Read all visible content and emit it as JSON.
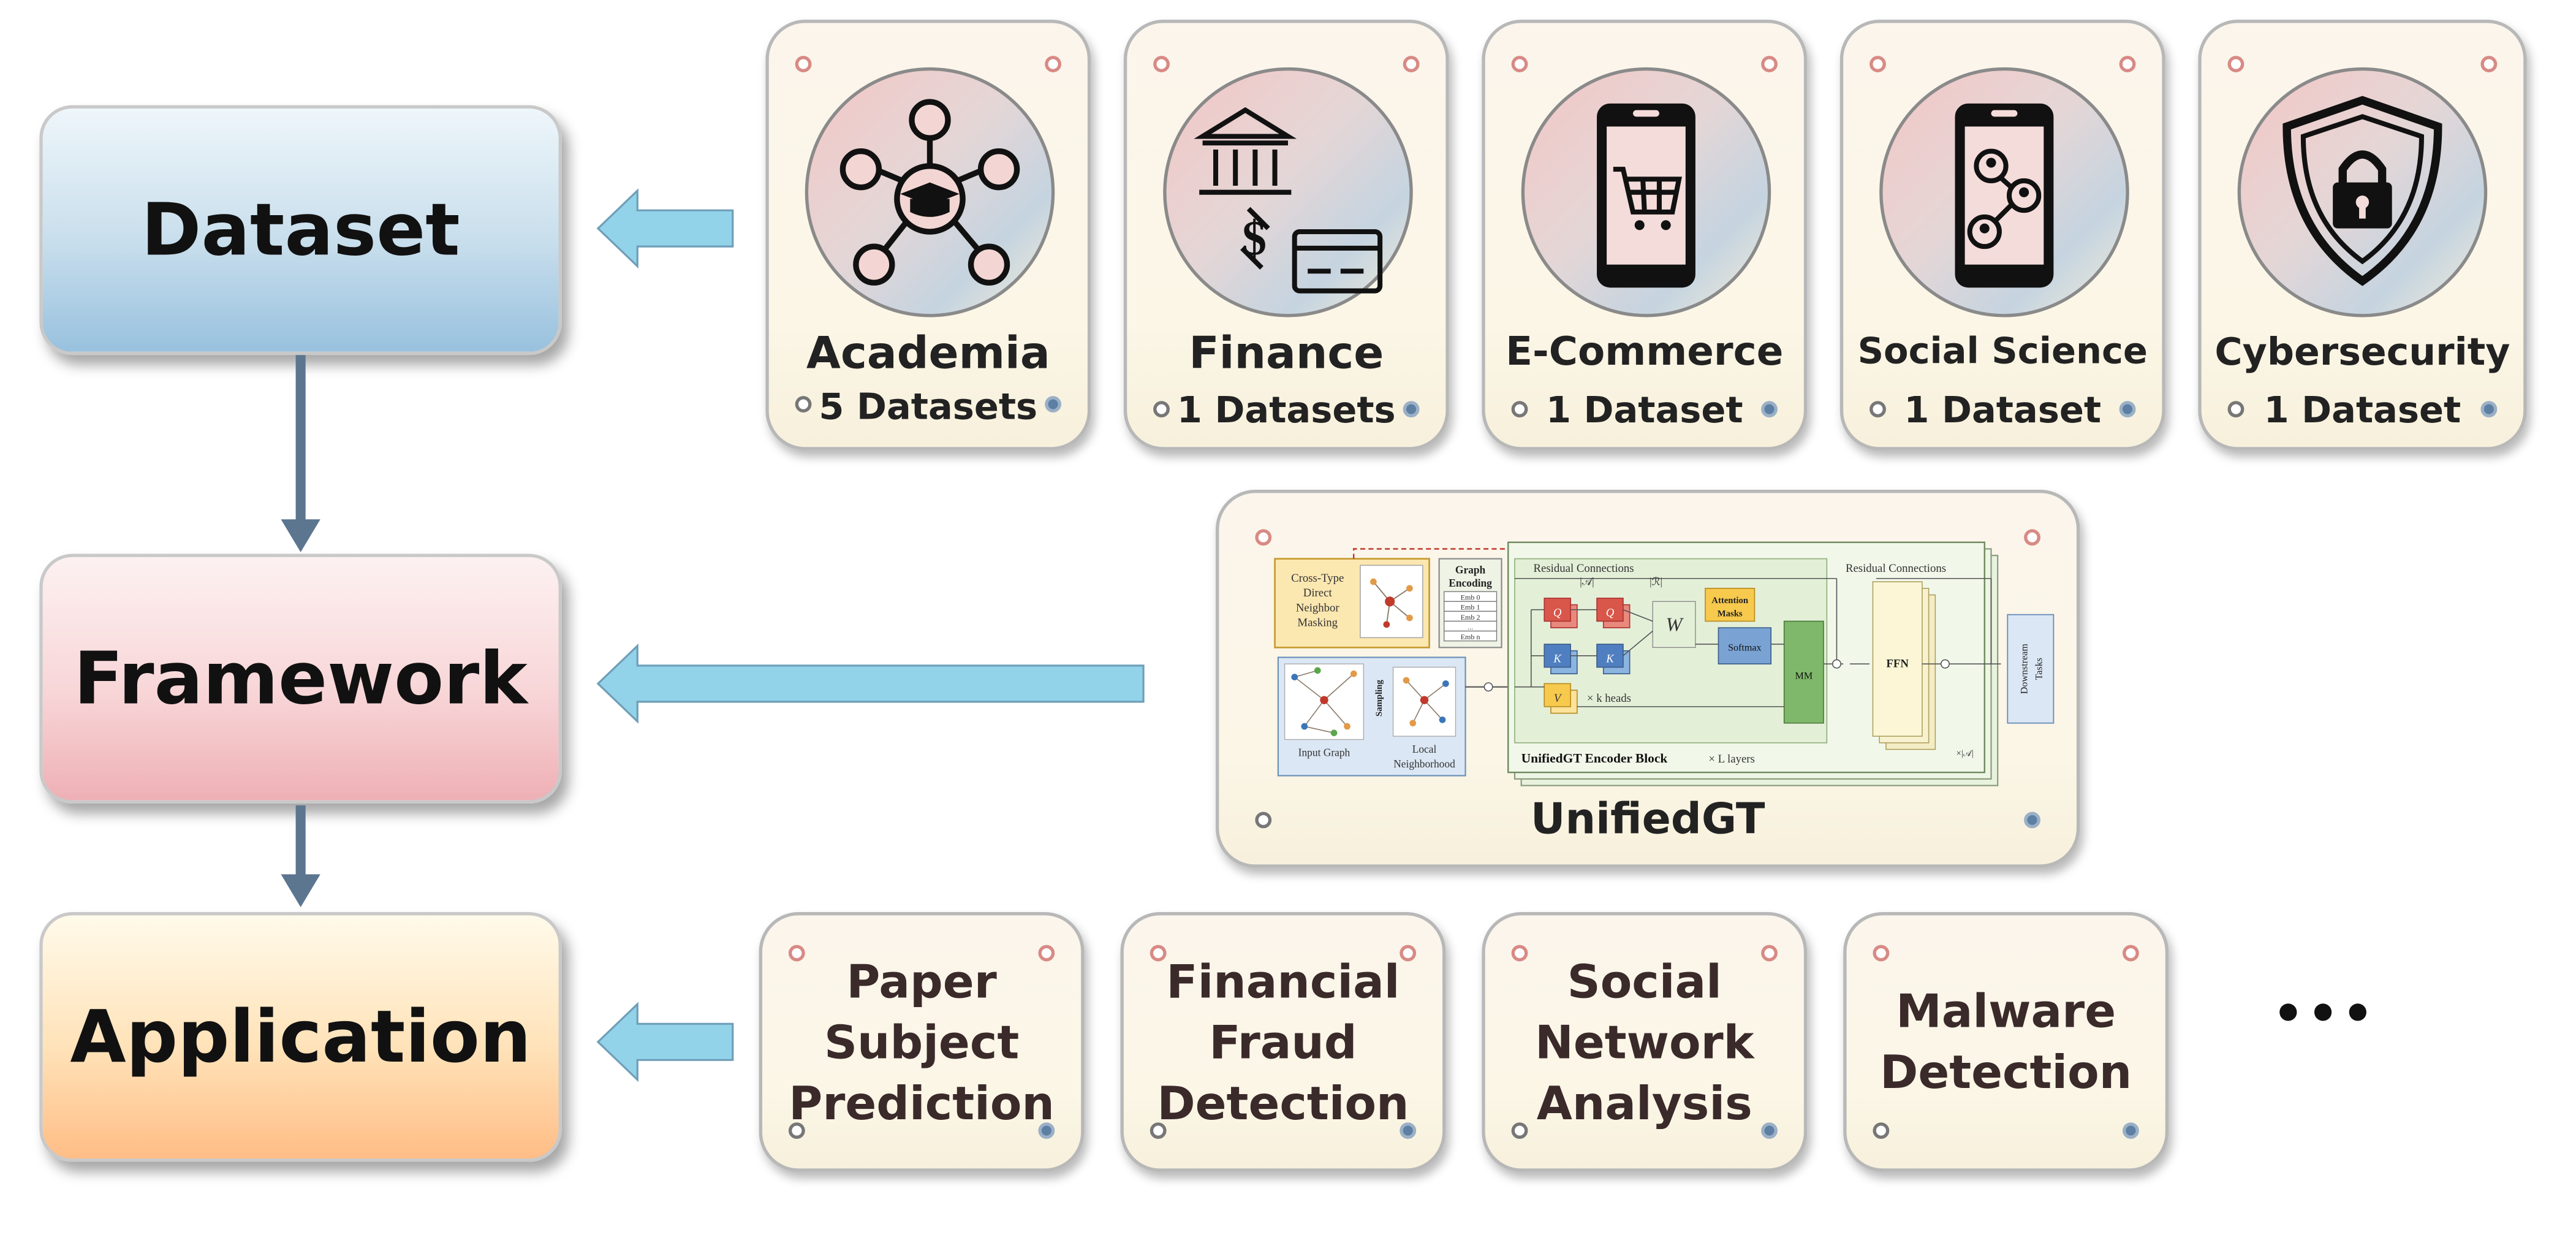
{
  "stages": {
    "dataset": "Dataset",
    "framework": "Framework",
    "application": "Application"
  },
  "domains": [
    {
      "name": "Academia",
      "count": "5 Datasets",
      "icon": "academic-network-icon"
    },
    {
      "name": "Finance",
      "count": "1 Datasets",
      "icon": "bank-finance-icon"
    },
    {
      "name": "E-Commerce",
      "count": "1 Dataset",
      "icon": "smartphone-cart-icon"
    },
    {
      "name": "Social Science",
      "count": "1 Dataset",
      "icon": "smartphone-network-icon"
    },
    {
      "name": "Cybersecurity",
      "count": "1 Dataset",
      "icon": "shield-lock-icon"
    }
  ],
  "framework_card": {
    "title": "UnifiedGT",
    "diagram": {
      "cross_type": [
        "Cross-Type",
        "Direct",
        "Neighbor",
        "Masking"
      ],
      "graph_encoding": [
        "Graph",
        "Encoding"
      ],
      "emb_rows": [
        "Emb 0",
        "Emb 1",
        "Emb 2",
        "...",
        "Emb n"
      ],
      "residual_left": "Residual Connections",
      "residual_right": "Residual Connections",
      "attention_masks": [
        "Attention",
        "Masks"
      ],
      "q": "Q",
      "k": "K",
      "v": "V",
      "softmax": "Softmax",
      "mm": "MM",
      "ffn": "FFN",
      "heads": "× k heads",
      "sampling": "Sampling",
      "input_graph": "Input Graph",
      "local_neighborhood": [
        "Local",
        "Neighborhood"
      ],
      "encoder_block": "UnifiedGT Encoder Block",
      "layers": "× L layers",
      "downstream": [
        "Downstream",
        "Tasks"
      ],
      "abs_a": "|𝒜|",
      "abs_r": "|ℛ|",
      "times_a": "×|𝒜|"
    }
  },
  "applications": [
    [
      "Paper",
      "Subject",
      "Prediction"
    ],
    [
      "Financial",
      "Fraud",
      "Detection"
    ],
    [
      "Social",
      "Network",
      "Analysis"
    ],
    [
      "Malware",
      "Detection"
    ]
  ],
  "ellipsis": "•••",
  "colors": {
    "dataset_box": [
      "#e8f2f8",
      "#9cc3de"
    ],
    "framework_box": [
      "#fbe9ea",
      "#eeb4b8"
    ],
    "application_box": [
      "#fff8e2",
      "#ffc08a"
    ],
    "arrow_fill": "#93d3ea",
    "flow_arrow": "#5c7690",
    "card_dot_pink": "#d88a85",
    "card_dot_blue": "#5c7fa3"
  }
}
